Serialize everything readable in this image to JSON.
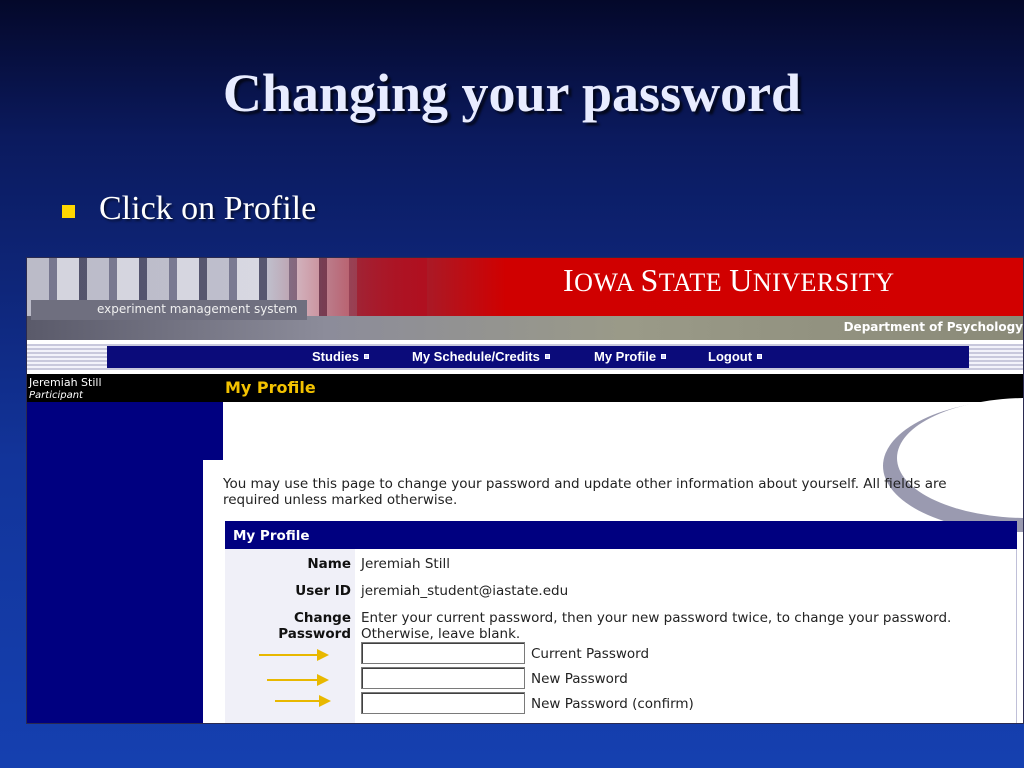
{
  "slide": {
    "title": "Changing your password",
    "bullet": "Click on Profile"
  },
  "banner": {
    "system_name": "experiment management system",
    "university_first": "I",
    "university_rest": "OWA ",
    "university_s": "S",
    "university_tate": "TATE ",
    "university_u": "U",
    "university_niversity": "NIVERSITY",
    "department": "Department of Psychology"
  },
  "nav": {
    "items": [
      {
        "label": "Studies"
      },
      {
        "label": "My Schedule/Credits"
      },
      {
        "label": "My Profile"
      },
      {
        "label": "Logout"
      }
    ]
  },
  "sidebar": {
    "user_name": "Jeremiah Still",
    "user_role": "Participant"
  },
  "page": {
    "title": "My Profile",
    "intro": "You may use this page to change your password and update other information about yourself. All fields are required unless marked otherwise."
  },
  "profile": {
    "panel_title": "My Profile",
    "name_label": "Name",
    "name_value": "Jeremiah Still",
    "userid_label": "User ID",
    "userid_value": "jeremiah_student@iastate.edu",
    "change_label_1": "Change",
    "change_label_2": "Password",
    "change_note": "Enter your current password, then your new password twice, to change your password. Otherwise, leave blank.",
    "current_password_label": "Current Password",
    "new_password_label": "New Password",
    "confirm_password_label": "New Password (confirm)"
  },
  "colors": {
    "arrow": "#e8b800",
    "nav_bar": "#0b0b7a",
    "title_yellow": "#f3c200"
  }
}
